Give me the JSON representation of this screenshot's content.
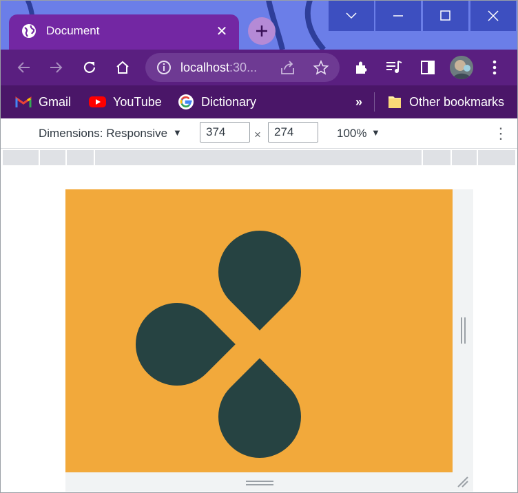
{
  "browser": {
    "tab": {
      "title": "Document",
      "close_glyph": "✕"
    },
    "new_tab_glyph": "+",
    "window_controls": {
      "menu": "﹀",
      "minimize": "—",
      "maximize": "☐",
      "close": "✕"
    },
    "address": {
      "host": "localhost",
      "rest": ":30..."
    },
    "icons": [
      "back-icon",
      "forward-icon",
      "reload-icon",
      "home-icon",
      "site-info-icon",
      "share-icon",
      "star-icon",
      "extensions-icon",
      "media-icon",
      "side-panel-icon",
      "profile-avatar",
      "menu-icon"
    ]
  },
  "bookmarks": {
    "items": [
      {
        "label": "Gmail",
        "icon": "gmail-icon"
      },
      {
        "label": "YouTube",
        "icon": "youtube-icon"
      },
      {
        "label": "Dictionary",
        "icon": "google-icon"
      }
    ],
    "overflow": "»",
    "other": "Other bookmarks"
  },
  "devtools": {
    "dimensions_label": "Dimensions: Responsive",
    "width": "374",
    "times": "×",
    "height": "274",
    "zoom": "100%",
    "dropdown_glyph": "▼",
    "more_glyph": "⋮"
  },
  "page": {
    "background": "#f2a93b",
    "shape_color": "#264342"
  },
  "colors": {
    "titlebar": "#6b7ee8",
    "tab": "#7327a3",
    "toolbar": "#5a1f80",
    "bookmarks_bar": "#4a1668"
  }
}
